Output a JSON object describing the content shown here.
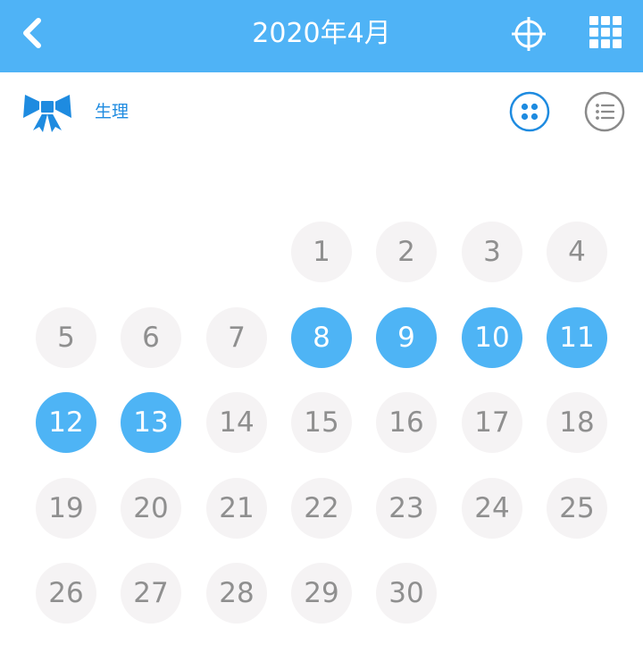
{
  "header": {
    "title": "2020年4月",
    "back_icon": "chevron-left-icon",
    "locate_icon": "crosshair-icon",
    "grid_icon": "grid-menu-icon"
  },
  "subheader": {
    "period_label": "生理",
    "bow_icon": "bow-icon",
    "grid_view_icon": "four-dots-icon",
    "list_view_icon": "list-icon"
  },
  "colors": {
    "accent": "#4eb4f5",
    "header_bg": "#4fb3f6",
    "label_blue": "#1e8be0",
    "day_bg": "#f5f3f4",
    "day_text": "#8f8f8f"
  },
  "calendar": {
    "days": [
      "1",
      "2",
      "3",
      "4",
      "5",
      "6",
      "7",
      "8",
      "9",
      "10",
      "11",
      "12",
      "13",
      "14",
      "15",
      "16",
      "17",
      "18",
      "19",
      "20",
      "21",
      "22",
      "23",
      "24",
      "25",
      "26",
      "27",
      "28",
      "29",
      "30"
    ],
    "selected_days": [
      "8",
      "9",
      "10",
      "11",
      "12",
      "13"
    ]
  }
}
